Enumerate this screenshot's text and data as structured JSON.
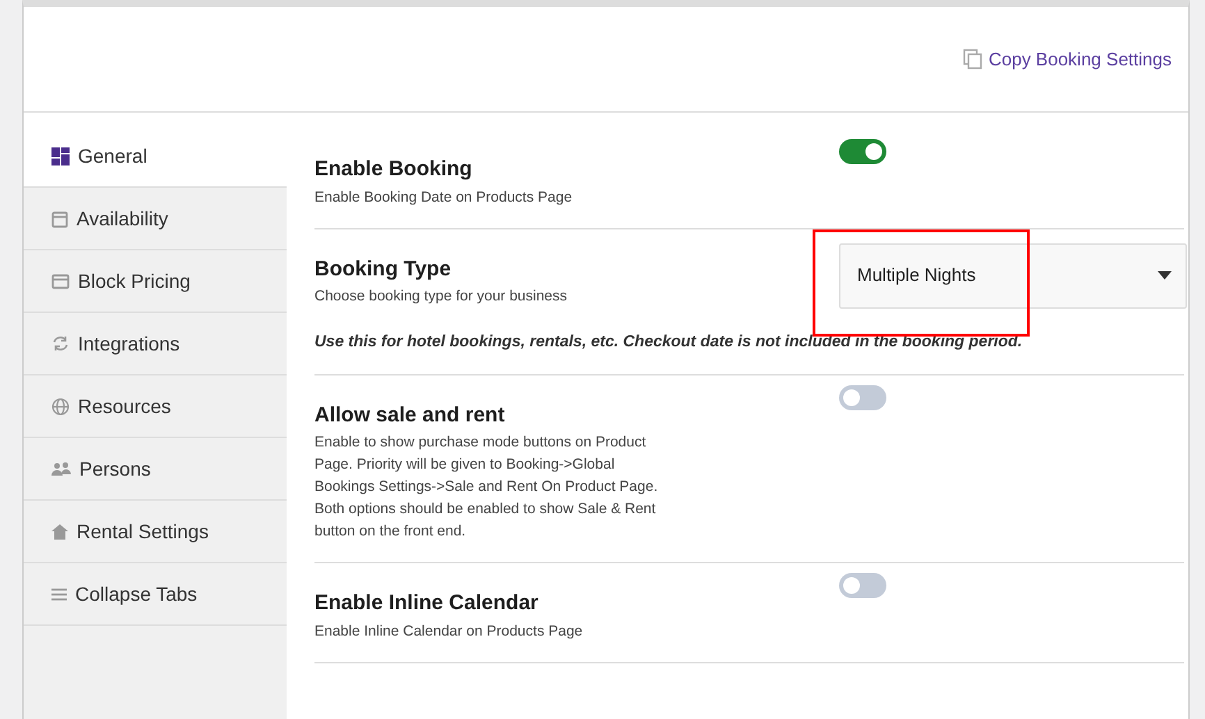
{
  "header": {
    "copy_link": "Copy Booking Settings"
  },
  "sidebar": {
    "items": [
      {
        "label": "General",
        "selected": true
      },
      {
        "label": "Availability",
        "selected": false
      },
      {
        "label": "Block Pricing",
        "selected": false
      },
      {
        "label": "Integrations",
        "selected": false
      },
      {
        "label": "Resources",
        "selected": false
      },
      {
        "label": "Persons",
        "selected": false
      },
      {
        "label": "Rental Settings",
        "selected": false
      },
      {
        "label": "Collapse Tabs",
        "selected": false
      }
    ]
  },
  "settings": [
    {
      "kind": "toggle",
      "title": "Enable Booking",
      "description": "Enable Booking Date on Products Page",
      "on": true,
      "highlighted": false
    },
    {
      "kind": "select",
      "title": "Booking Type",
      "description": "Choose booking type for your business",
      "value": "Multiple Nights",
      "note": "Use this for hotel bookings, rentals, etc. Checkout date is not included in the booking period.",
      "highlighted": true
    },
    {
      "kind": "toggle",
      "title": "Allow sale and rent",
      "description": "Enable to show purchase mode buttons on Product Page. Priority will be given to Booking->Global Bookings Settings->Sale and Rent On Product Page. Both options should be enabled to show Sale & Rent button on the front end.",
      "on": false,
      "highlighted": false
    },
    {
      "kind": "toggle",
      "title": "Enable Inline Calendar",
      "description": "Enable Inline Calendar on Products Page",
      "on": false,
      "highlighted": false
    }
  ]
}
